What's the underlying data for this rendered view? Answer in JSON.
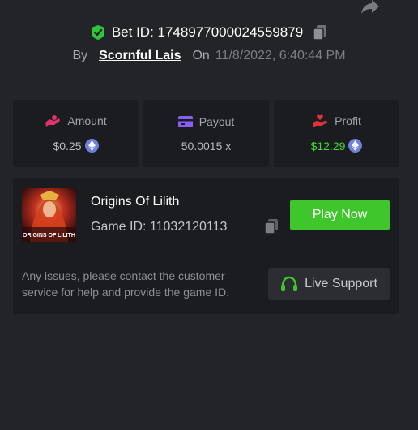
{
  "header": {
    "bet_label": "Bet ID: 1748977000024559879",
    "by_label": "By",
    "username": "Scornful Lais",
    "on_label": "On",
    "datetime": "11/8/2022, 6:40:44 PM"
  },
  "stats": [
    {
      "label": "Amount",
      "value": "$0.25",
      "icon": "hand-coin-icon",
      "icon_color": "#e0336e",
      "currency": "eth"
    },
    {
      "label": "Payout",
      "value": "50.0015 x",
      "icon": "card-icon",
      "icon_color": "#8b5cf6"
    },
    {
      "label": "Profit",
      "value": "$12.29",
      "icon": "hand-heart-icon",
      "icon_color": "#e2313a",
      "currency": "eth",
      "value_color": "#3ddc2f"
    }
  ],
  "game": {
    "title": "Origins Of Lilith",
    "game_id": "Game ID: 11032120113",
    "thumb_caption": "ORIGINS OF LILITH",
    "play_label": "Play Now"
  },
  "support": {
    "text": "Any issues, please contact the customer service for help and provide the game ID.",
    "button_label": "Live Support"
  },
  "colors": {
    "background": "#232428",
    "card": "#1b1c1f",
    "accent_green": "#3ec62c",
    "shield_green": "#2fc43a"
  }
}
